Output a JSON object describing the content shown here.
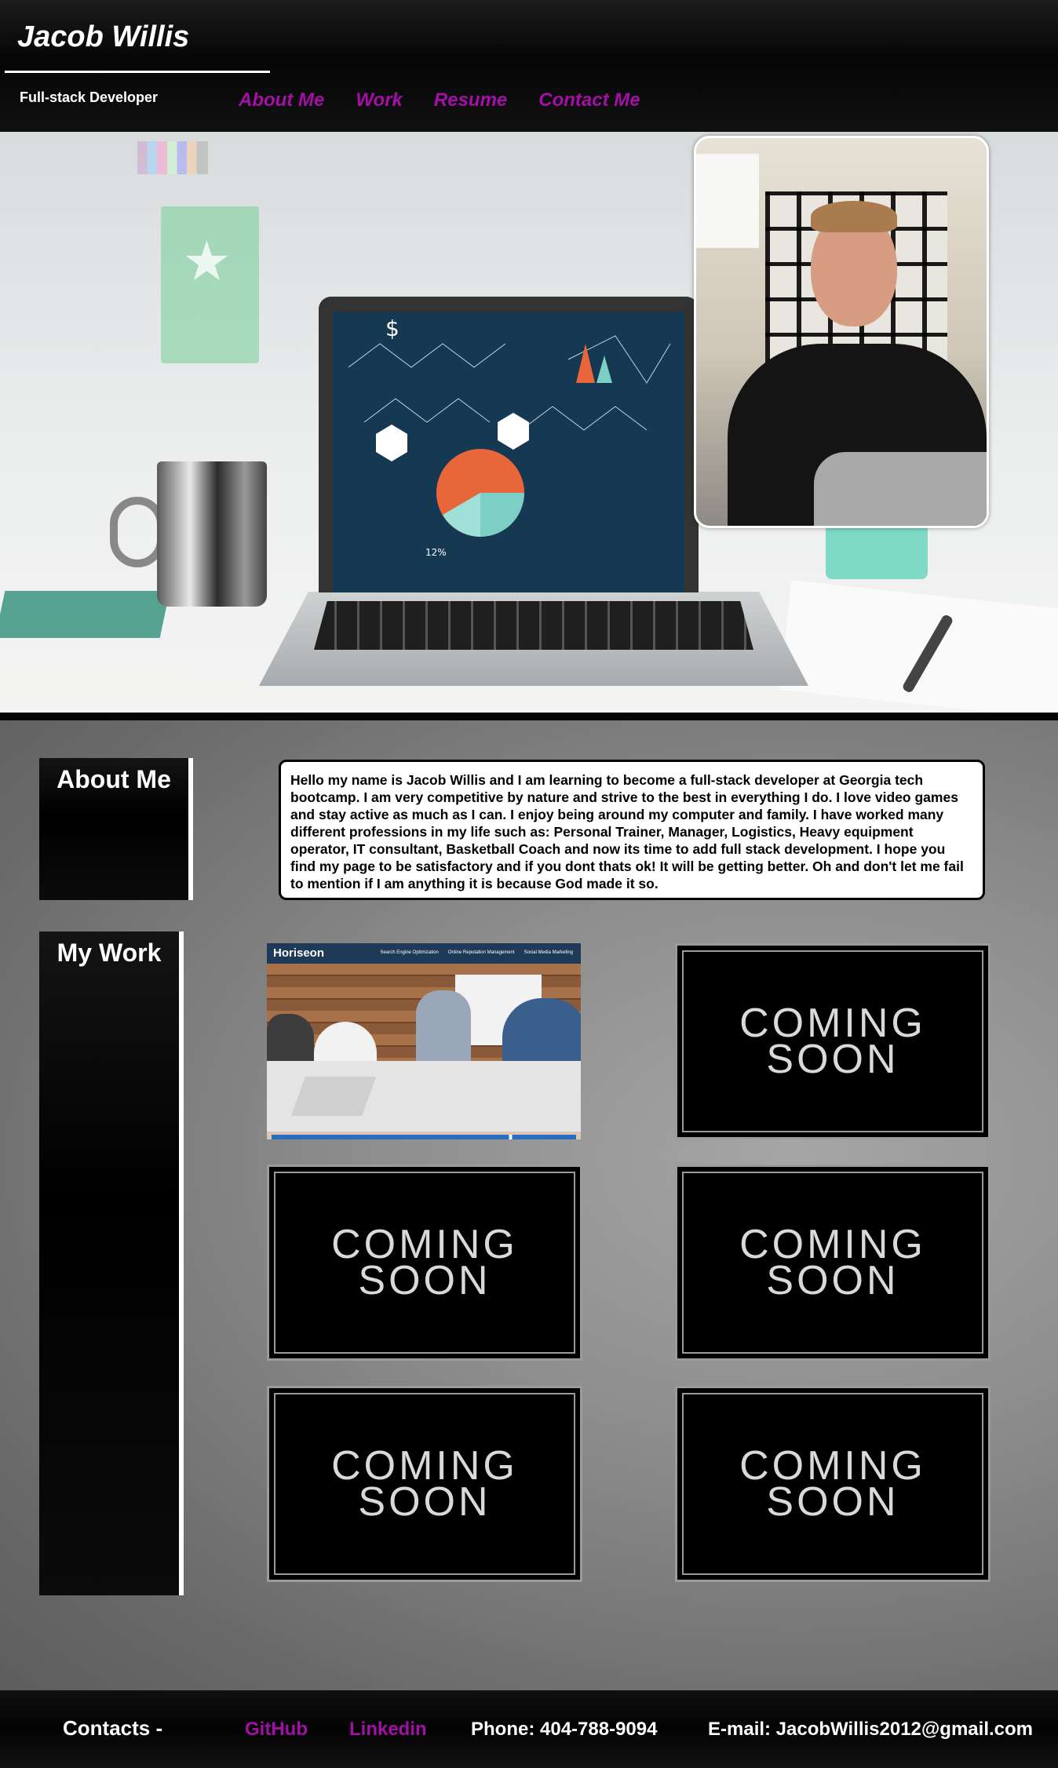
{
  "header": {
    "name": "Jacob Willis",
    "role": "Full-stack Developer",
    "nav": [
      {
        "label": "About Me"
      },
      {
        "label": "Work"
      },
      {
        "label": "Resume"
      },
      {
        "label": "Contact Me"
      }
    ]
  },
  "hero": {
    "image": "desk-laptop-photo",
    "profile_photo": "profile-selfie-photo"
  },
  "about": {
    "label": "About Me",
    "text": "Hello my name is Jacob Willis and I am learning to become a full-stack developer at Georgia tech bootcamp. I am very competitive by nature and strive to the best in everything I do. I love video games and stay active as much as I can. I enjoy being around my computer and family. I have worked many different professions in my life such as: Personal Trainer, Manager, Logistics, Heavy equipment operator, IT consultant, Basketball Coach and now its time to add full stack development. I hope you find my page to be satisfactory and if you dont thats ok! It will be getting better. Oh and don't let me fail to mention if I am anything it is because God made it so."
  },
  "work": {
    "label": "My Work",
    "project": {
      "brand": "Horiseon",
      "nav": [
        "Search Engine Optimization",
        "Online Reputation Management",
        "Social Media Marketing"
      ]
    },
    "tiles": [
      {
        "line1": "COMING",
        "line2": "SOON"
      },
      {
        "line1": "COMING",
        "line2": "SOON"
      },
      {
        "line1": "COMING",
        "line2": "SOON"
      },
      {
        "line1": "COMING",
        "line2": "SOON"
      },
      {
        "line1": "COMING",
        "line2": "SOON"
      }
    ]
  },
  "footer": {
    "contacts_label": "Contacts -",
    "github": "GitHub",
    "linkedin": "Linkedin",
    "phone": "Phone: 404-788-9094",
    "email": "E-mail: JacobWillis2012@gmail.com"
  },
  "colors": {
    "accent": "#a40fa8",
    "header_bg": "#050505",
    "main_bg": "#8c8c8c"
  }
}
